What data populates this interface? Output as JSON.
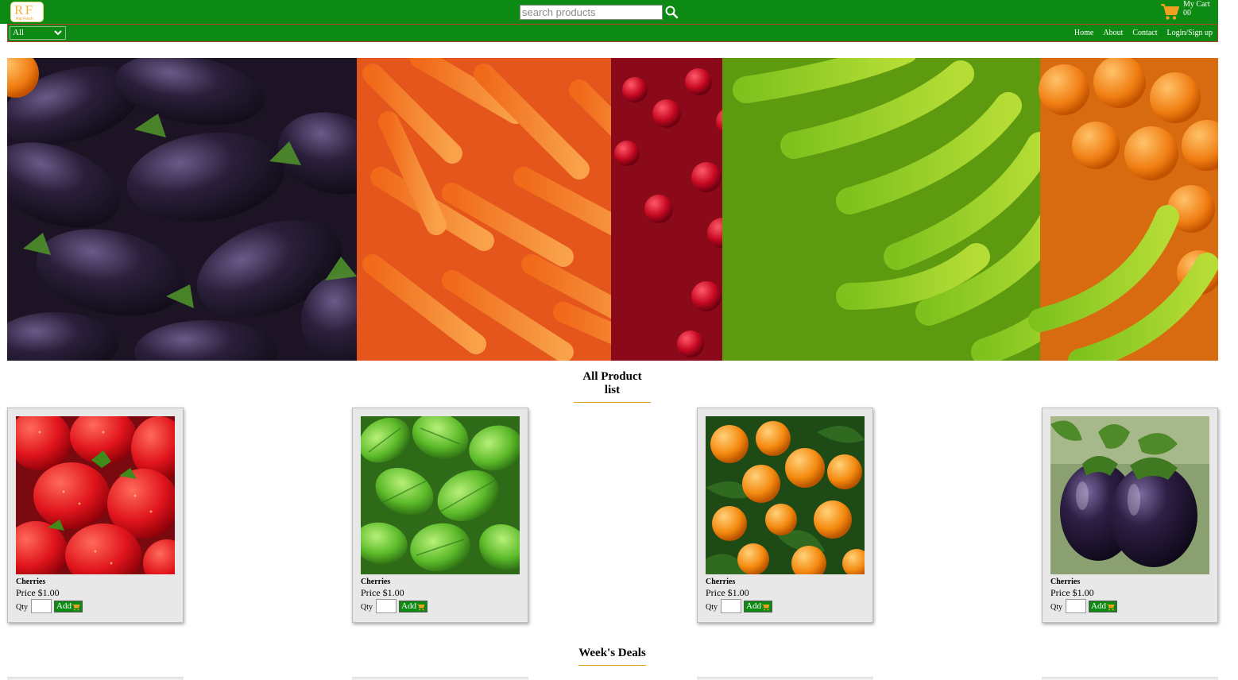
{
  "header": {
    "logo_mark": "R F",
    "logo_sub": "Raj Fresh",
    "search_placeholder": "search products",
    "cart_label": "My Cart",
    "cart_count": "00"
  },
  "nav": {
    "category_selected": "All",
    "links": [
      "Home",
      "About",
      "Contact",
      "Login/Sign up"
    ]
  },
  "sections": {
    "all_products": "All Product list",
    "weeks_deals": "Week's Deals"
  },
  "products": [
    {
      "name": "Cherries",
      "price": "Price $1.00",
      "qty_label": "Qty",
      "add_label": "Add",
      "image": "strawberries"
    },
    {
      "name": "Cherries",
      "price": "Price $1.00",
      "qty_label": "Qty",
      "add_label": "Add",
      "image": "mint-leaves"
    },
    {
      "name": "Cherries",
      "price": "Price $1.00",
      "qty_label": "Qty",
      "add_label": "Add",
      "image": "oranges"
    },
    {
      "name": "Cherries",
      "price": "Price $1.00",
      "qty_label": "Qty",
      "add_label": "Add",
      "image": "eggplants"
    }
  ],
  "colors": {
    "brand_green": "#0d8a13",
    "accent_orange": "#e3a21a",
    "nav_border": "#c0392b"
  }
}
